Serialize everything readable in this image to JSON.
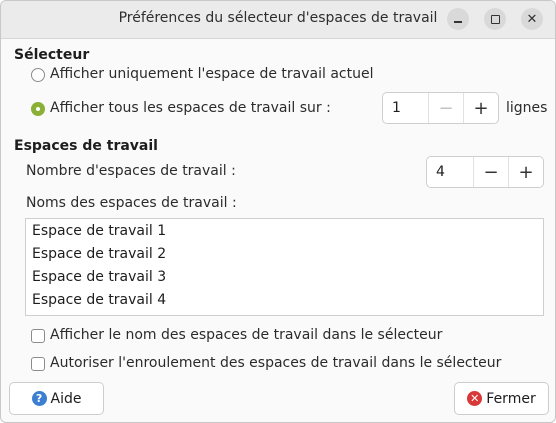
{
  "window": {
    "title": "Préférences du sélecteur d'espaces de travail"
  },
  "selector": {
    "heading": "Sélecteur",
    "option_current": "Afficher uniquement l'espace de travail actuel",
    "option_all": "Afficher tous les espaces de travail sur :",
    "selected_option": "option_all",
    "rows_value": "1",
    "rows_unit": "lignes"
  },
  "workspaces": {
    "heading": "Espaces de travail",
    "count_label": "Nombre d'espaces de travail :",
    "count_value": "4",
    "names_label": "Noms des espaces de travail :",
    "names": [
      "Espace de travail 1",
      "Espace de travail 2",
      "Espace de travail 3",
      "Espace de travail 4"
    ],
    "show_names_label": "Afficher le nom des espaces de travail dans le sélecteur",
    "show_names_checked": false,
    "wrap_label": "Autoriser l'enroulement des espaces de travail dans le sélecteur",
    "wrap_checked": false
  },
  "footer": {
    "help_label": "Aide",
    "close_label": "Fermer"
  },
  "icons": {
    "help": "help-icon",
    "close": "close-icon",
    "minimize": "minimize-icon",
    "maximize": "maximize-icon",
    "window_close": "window-close-icon",
    "plus": "+",
    "minus": "−"
  },
  "colors": {
    "radio_accent": "#8bb036",
    "help_icon": "#3b7fd3",
    "close_icon": "#d93838"
  }
}
